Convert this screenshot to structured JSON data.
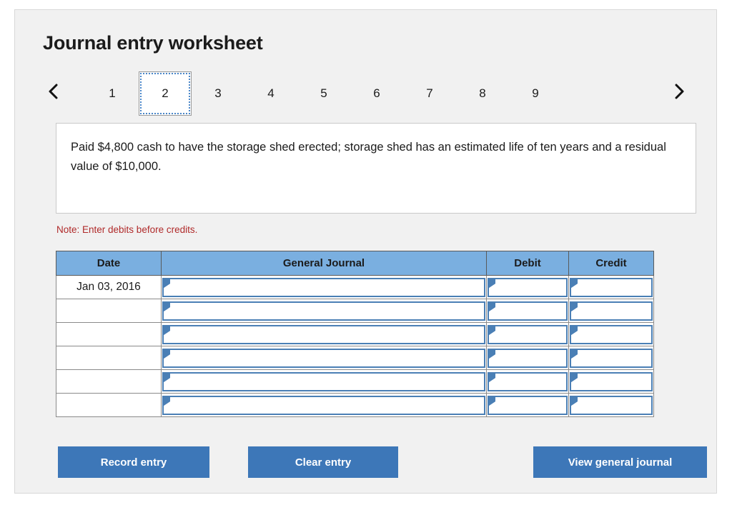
{
  "page": {
    "title": "Journal entry worksheet"
  },
  "tabs": {
    "prev_icon": "chevron-left-icon",
    "next_icon": "chevron-right-icon",
    "items": [
      {
        "label": "1",
        "active": false
      },
      {
        "label": "2",
        "active": true
      },
      {
        "label": "3",
        "active": false
      },
      {
        "label": "4",
        "active": false
      },
      {
        "label": "5",
        "active": false
      },
      {
        "label": "6",
        "active": false
      },
      {
        "label": "7",
        "active": false
      },
      {
        "label": "8",
        "active": false
      },
      {
        "label": "9",
        "active": false
      }
    ],
    "active_label": "2"
  },
  "description": {
    "text": "Paid $4,800 cash to have the storage shed erected; storage shed has an estimated life of ten years and a residual value of $10,000."
  },
  "note": {
    "text": "Note: Enter debits before credits."
  },
  "journal": {
    "columns": [
      "Date",
      "General Journal",
      "Debit",
      "Credit"
    ],
    "rows": [
      {
        "date": "Jan 03, 2016",
        "general_journal": "",
        "debit": "",
        "credit": ""
      },
      {
        "date": "",
        "general_journal": "",
        "debit": "",
        "credit": ""
      },
      {
        "date": "",
        "general_journal": "",
        "debit": "",
        "credit": ""
      },
      {
        "date": "",
        "general_journal": "",
        "debit": "",
        "credit": ""
      },
      {
        "date": "",
        "general_journal": "",
        "debit": "",
        "credit": ""
      },
      {
        "date": "",
        "general_journal": "",
        "debit": "",
        "credit": ""
      }
    ]
  },
  "buttons": {
    "record": "Record entry",
    "clear": "Clear entry",
    "view": "View general journal"
  },
  "colors": {
    "header_blue": "#7aafe0",
    "button_blue": "#3d77b8",
    "note_red": "#b02a2a",
    "field_border_blue": "#4a7fb5",
    "card_background": "#f1f1f1"
  }
}
